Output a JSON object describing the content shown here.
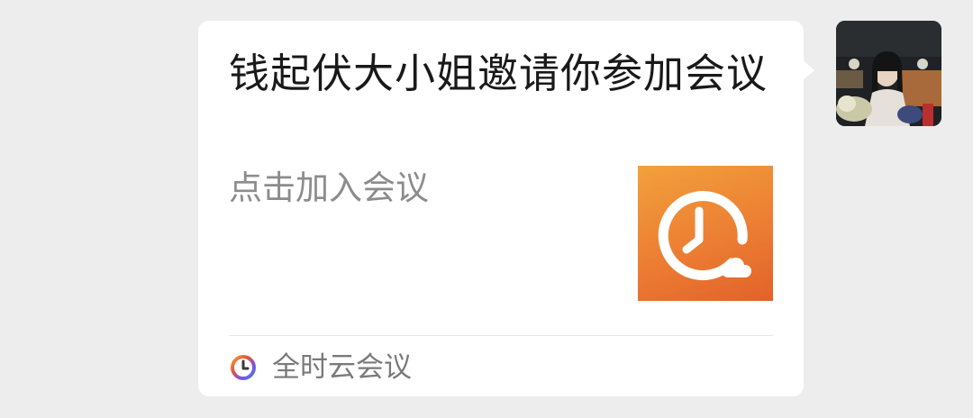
{
  "message": {
    "title": "钱起伏大小姐邀请你参加会议",
    "description": "点击加入会议",
    "app_name": "全时云会议",
    "thumbnail_icon": "alarm-clock-cloud-icon",
    "app_icon": "quanshi-logo-icon"
  },
  "sender": {
    "avatar_icon": "user-avatar"
  },
  "colors": {
    "background": "#ededed",
    "bubble": "#ffffff",
    "thumbnail_top": "#f2a13c",
    "thumbnail_bottom": "#e2622a",
    "title_text": "#191919",
    "secondary_text": "#8c8c8c"
  }
}
